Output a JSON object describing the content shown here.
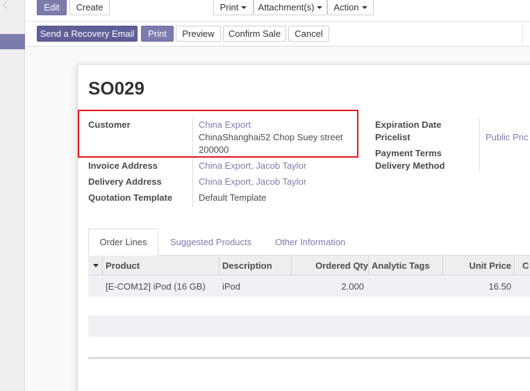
{
  "control_panel": {
    "edit_label": "Edit",
    "create_label": "Create",
    "print_menu_label": "Print",
    "attachments_menu_label": "Attachment(s)",
    "action_menu_label": "Action"
  },
  "statusbar": {
    "buttons": [
      "Send a Recovery Email",
      "Print",
      "Preview",
      "Confirm Sale",
      "Cancel"
    ]
  },
  "record": {
    "name": "SO029",
    "left_fields": {
      "customer_label": "Customer",
      "customer_name": "China Export",
      "customer_address_line1": "ChinaShanghai52 Chop Suey street",
      "customer_address_line2": "200000",
      "invoice_address_label": "Invoice Address",
      "invoice_address_value": "China Export, Jacob Taylor",
      "delivery_address_label": "Delivery Address",
      "delivery_address_value": "China Export, Jacob Taylor",
      "quotation_template_label": "Quotation Template",
      "quotation_template_value": "Default Template"
    },
    "right_fields": {
      "expiration_date_label": "Expiration Date",
      "pricelist_label": "Pricelist",
      "pricelist_value": "Public Pric",
      "payment_terms_label": "Payment Terms",
      "delivery_method_label": "Delivery Method"
    }
  },
  "tabs": [
    "Order Lines",
    "Suggested Products",
    "Other Information"
  ],
  "order_lines": {
    "columns": [
      "Product",
      "Description",
      "Ordered Qty",
      "Analytic Tags",
      "Unit Price",
      "C"
    ],
    "rows": [
      {
        "product": "[E-COM12] iPod (16 GB)",
        "description": "iPod",
        "ordered_qty": "2.000",
        "analytic_tags": "",
        "unit_price": "16.50"
      }
    ]
  },
  "colors": {
    "brand": "#7c7bad",
    "brand_dark": "#5f5e97",
    "highlight": "#e8101a"
  }
}
